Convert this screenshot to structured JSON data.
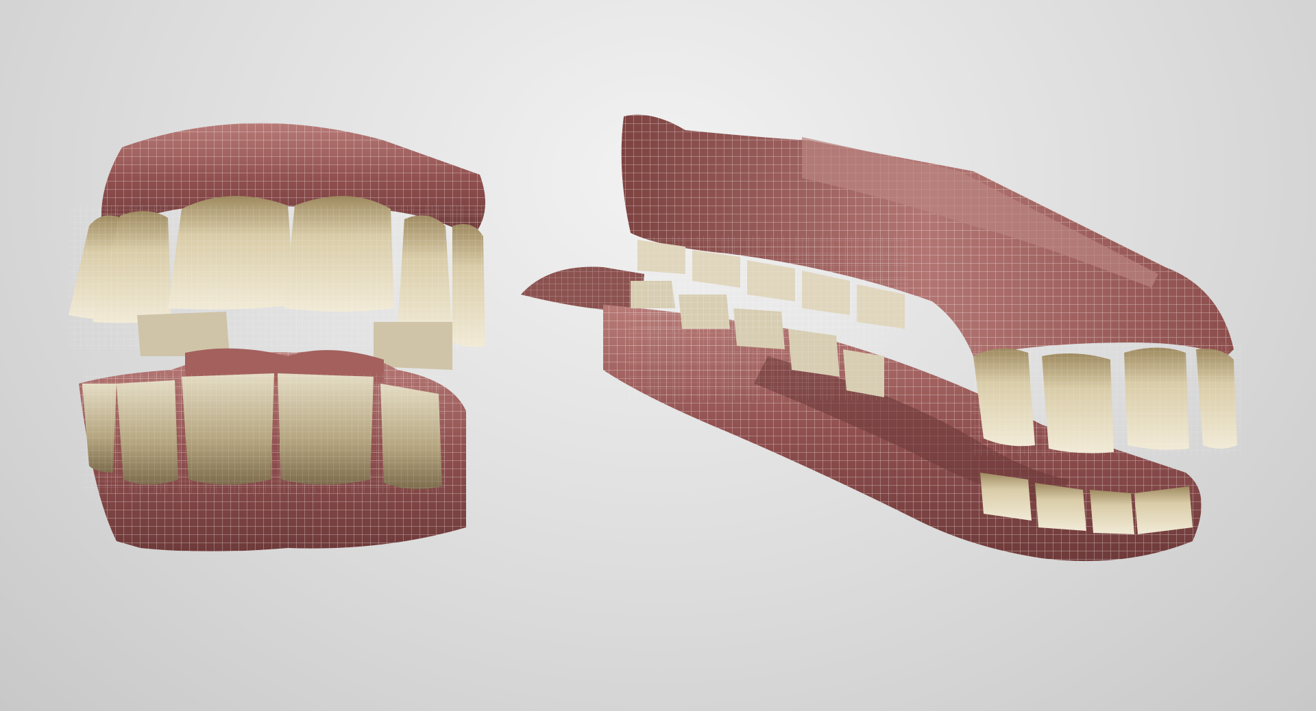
{
  "scene": {
    "background_color": "#d8d8d8",
    "gum_color": "#9a5a58",
    "gum_highlight": "#c7918c",
    "tooth_color": "#e9e0c8",
    "tooth_shadow": "#a59570",
    "wire_color": "#ffffff",
    "models": [
      {
        "name": "front-view-dentition"
      },
      {
        "name": "side-view-dentition"
      }
    ]
  }
}
